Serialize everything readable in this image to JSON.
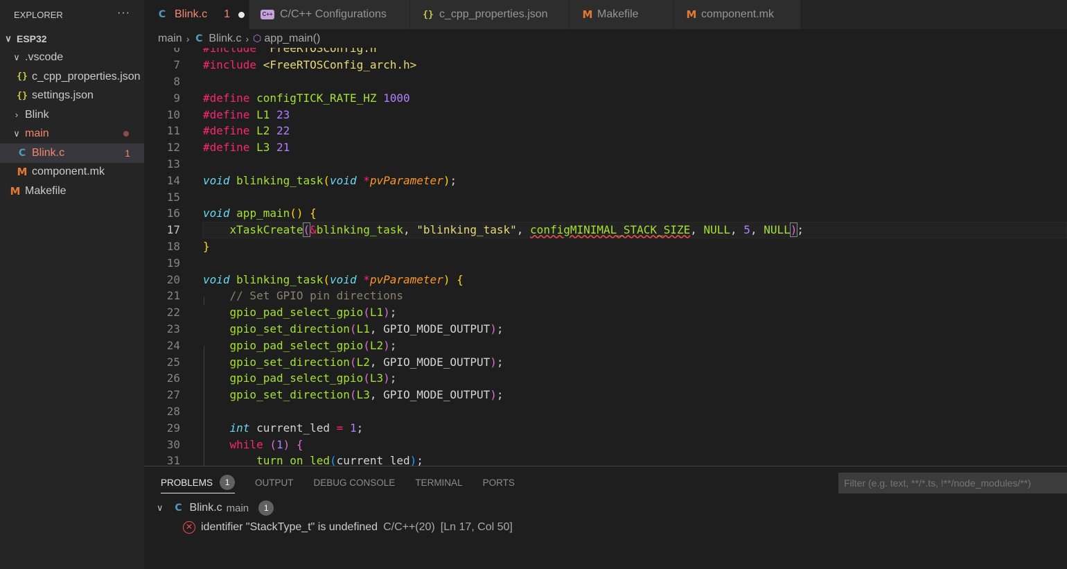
{
  "explorer": {
    "title": "EXPLORER",
    "more": "···",
    "root": "ESP32",
    "items": [
      {
        "label": ".vscode",
        "kind": "folder"
      },
      {
        "label": "c_cpp_properties.json",
        "kind": "json"
      },
      {
        "label": "settings.json",
        "kind": "json"
      },
      {
        "label": "Blink",
        "kind": "folder"
      },
      {
        "label": "main",
        "kind": "folder"
      },
      {
        "label": "Blink.c",
        "kind": "c",
        "badge": "1"
      },
      {
        "label": "component.mk",
        "kind": "mk"
      },
      {
        "label": "Makefile",
        "kind": "mk"
      }
    ]
  },
  "tabs": [
    {
      "label": "Blink.c",
      "icon": "C",
      "badge": "1"
    },
    {
      "label": "C/C++ Configurations",
      "icon": "C++"
    },
    {
      "label": "c_cpp_properties.json",
      "icon": "{}"
    },
    {
      "label": "Makefile",
      "icon": "M"
    },
    {
      "label": "component.mk",
      "icon": "M"
    }
  ],
  "breadcrumb": {
    "folder": "main",
    "file": "Blink.c",
    "symbol": "app_main()"
  },
  "editor": {
    "line_numbers": [
      "6",
      "7",
      "8",
      "9",
      "10",
      "11",
      "12",
      "13",
      "14",
      "15",
      "16",
      "17",
      "18",
      "19",
      "20",
      "21",
      "22",
      "23",
      "24",
      "25",
      "26",
      "27",
      "28",
      "29",
      "30",
      "31"
    ],
    "current_line": "17"
  },
  "panel": {
    "tabs": [
      "PROBLEMS",
      "OUTPUT",
      "DEBUG CONSOLE",
      "TERMINAL",
      "PORTS"
    ],
    "problem_count": "1",
    "filter_placeholder": "Filter (e.g. text, **/*.ts, !**/node_modules/**)",
    "file": "Blink.c",
    "file_dir": "main",
    "file_count": "1",
    "error_message": "identifier \"StackType_t\" is undefined",
    "error_source": "C/C++(20)",
    "error_location": "[Ln 17, Col 50]"
  },
  "colors": {
    "keyword_pink": "#f92672",
    "type_blue": "#66d9ef",
    "func_green": "#a6e22e",
    "number_purple": "#ae81ff",
    "string_yellow": "#e6db74",
    "param_orange": "#fd971f",
    "comment_gray": "#88846f"
  }
}
